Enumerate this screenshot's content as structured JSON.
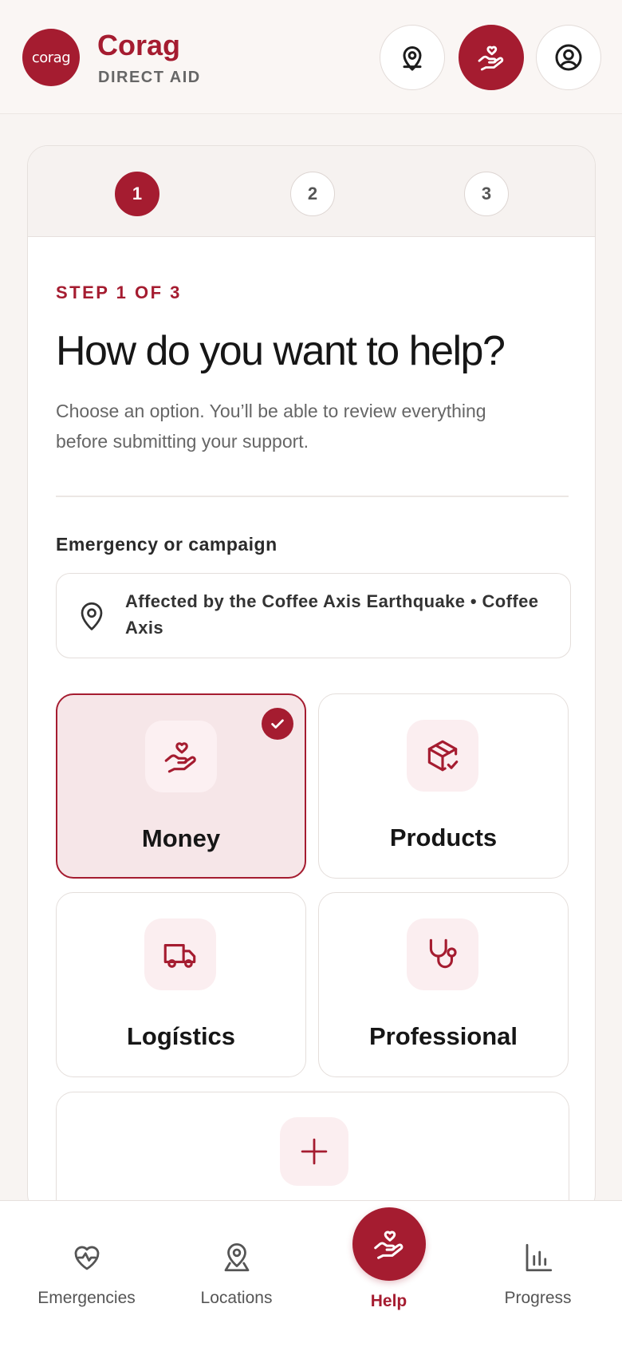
{
  "colors": {
    "accent": "#a51c30",
    "accent_soft": "#fbeef0",
    "selected_bg": "#f6e6e8"
  },
  "header": {
    "logo_text": "corag",
    "brand_name": "Corag",
    "brand_sub": "DIRECT AID",
    "icons": [
      "location-pin-icon",
      "hand-heart-icon",
      "user-circle-icon"
    ]
  },
  "stepper": {
    "steps": [
      "1",
      "2",
      "3"
    ],
    "current": 1
  },
  "main": {
    "step_label": "STEP 1 OF 3",
    "title": "How do you want to help?",
    "description": "Choose an option. You’ll be able to review everything before submitting your support.",
    "campaign_label": "Emergency or campaign",
    "campaign_value": "Affected by the Coffee Axis Earthquake • Coffee Axis",
    "options": [
      {
        "label": "Money",
        "icon": "hand-heart-icon",
        "selected": true
      },
      {
        "label": "Products",
        "icon": "package-check-icon",
        "selected": false
      },
      {
        "label": "Logístics",
        "icon": "truck-icon",
        "selected": false
      },
      {
        "label": "Professional",
        "icon": "stethoscope-icon",
        "selected": false
      }
    ],
    "add_option_icon": "plus-icon"
  },
  "bottom_nav": {
    "items": [
      {
        "label": "Emergencies",
        "icon": "heart-pulse-icon"
      },
      {
        "label": "Locations",
        "icon": "location-pin-icon"
      },
      {
        "label": "Help",
        "icon": "hand-heart-icon",
        "active": true
      },
      {
        "label": "Progress",
        "icon": "bar-chart-icon"
      }
    ]
  }
}
